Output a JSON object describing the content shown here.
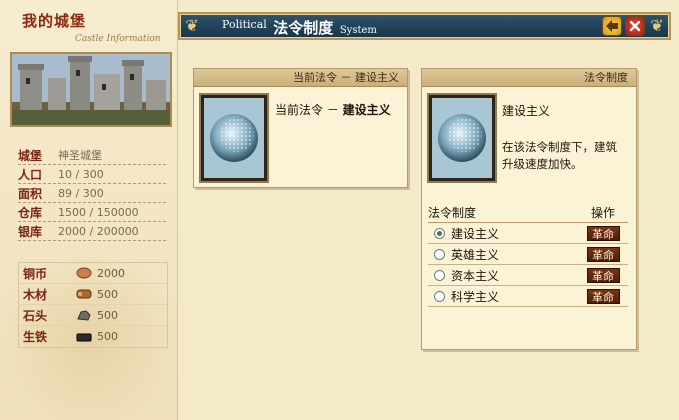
{
  "left": {
    "title": "我的城堡",
    "subtitle": "Castle Information",
    "stats": [
      {
        "label": "城堡",
        "value": "神圣城堡"
      },
      {
        "label": "人口",
        "value": "10 / 300"
      },
      {
        "label": "面积",
        "value": "89 / 300"
      },
      {
        "label": "仓库",
        "value": "1500 / 150000"
      },
      {
        "label": "银库",
        "value": "2000 / 200000"
      }
    ],
    "resources": [
      {
        "label": "铜币",
        "value": "2000",
        "icon": "coin-icon"
      },
      {
        "label": "木材",
        "value": "500",
        "icon": "wood-icon"
      },
      {
        "label": "石头",
        "value": "500",
        "icon": "stone-icon"
      },
      {
        "label": "生铁",
        "value": "500",
        "icon": "iron-icon"
      }
    ]
  },
  "header": {
    "title_en1": "Political",
    "title_cn": "法令制度",
    "title_en2": "System"
  },
  "current_panel": {
    "heading": "当前法令 － 建设主义",
    "text_prefix": "当前法令 －",
    "text_value": "建设主义"
  },
  "system_panel": {
    "heading": "法令制度",
    "selected_name": "建设主义",
    "description": "在该法令制度下，建筑升级速度加快。",
    "table_header": {
      "name": "法令制度",
      "action": "操作"
    },
    "rows": [
      {
        "name": "建设主义",
        "action": "革命",
        "selected": true
      },
      {
        "name": "英雄主义",
        "action": "革命",
        "selected": false
      },
      {
        "name": "资本主义",
        "action": "革命",
        "selected": false
      },
      {
        "name": "科学主义",
        "action": "革命",
        "selected": false
      }
    ]
  },
  "colors": {
    "accent_red": "#7b2610",
    "header_blue": "#183448",
    "button_brown": "#5e250a"
  }
}
